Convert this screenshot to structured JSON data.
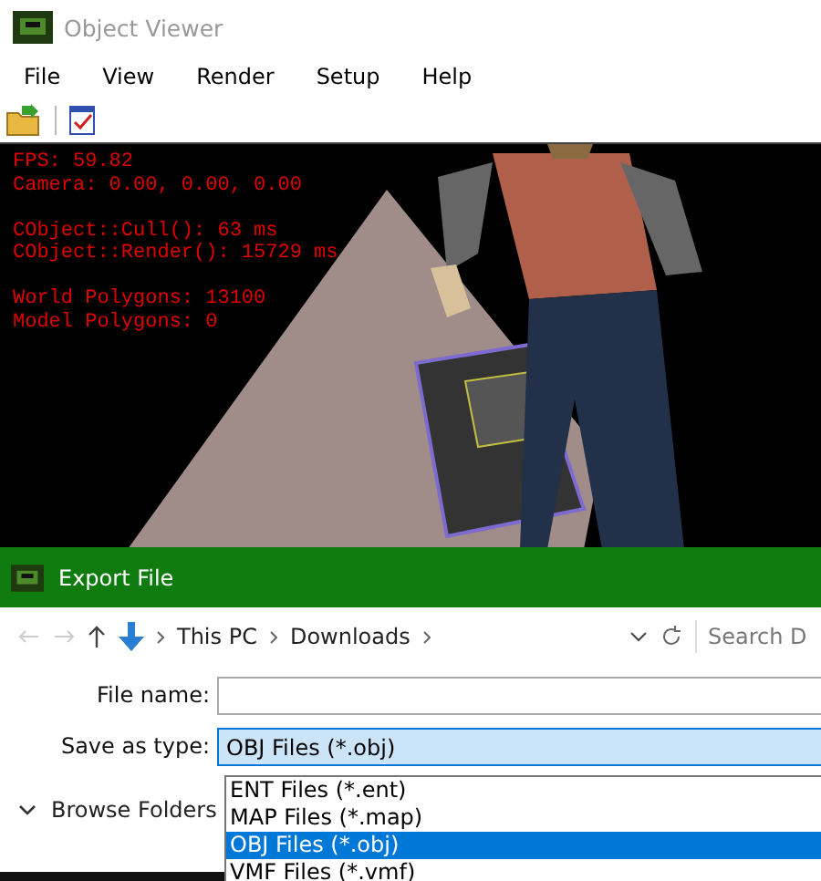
{
  "window": {
    "title": "Object Viewer"
  },
  "menu": [
    "File",
    "View",
    "Render",
    "Setup",
    "Help"
  ],
  "overlay": [
    [
      "FPS: 59.82",
      "Camera: 0.00, 0.00, 0.00"
    ],
    [
      "CObject::Cull(): 63 ms",
      "CObject::Render(): 15729 ms"
    ],
    [
      "World Polygons: 13100",
      "Model Polygons: 0"
    ]
  ],
  "dialog": {
    "title": "Export File",
    "breadcrumb": [
      "This PC",
      "Downloads"
    ],
    "search": {
      "placeholder": "Search D"
    },
    "file_name": {
      "label": "File name:"
    },
    "save_as_type": {
      "label": "Save as type:",
      "value": "OBJ Files (*.obj)",
      "options": [
        {
          "label": "ENT Files (*.ent)",
          "selected": false
        },
        {
          "label": "MAP Files (*.map)",
          "selected": false
        },
        {
          "label": "OBJ Files (*.obj)",
          "selected": true
        },
        {
          "label": "VMF Files (*.vmf)",
          "selected": false
        }
      ]
    },
    "browse_folders": "Browse Folders"
  }
}
